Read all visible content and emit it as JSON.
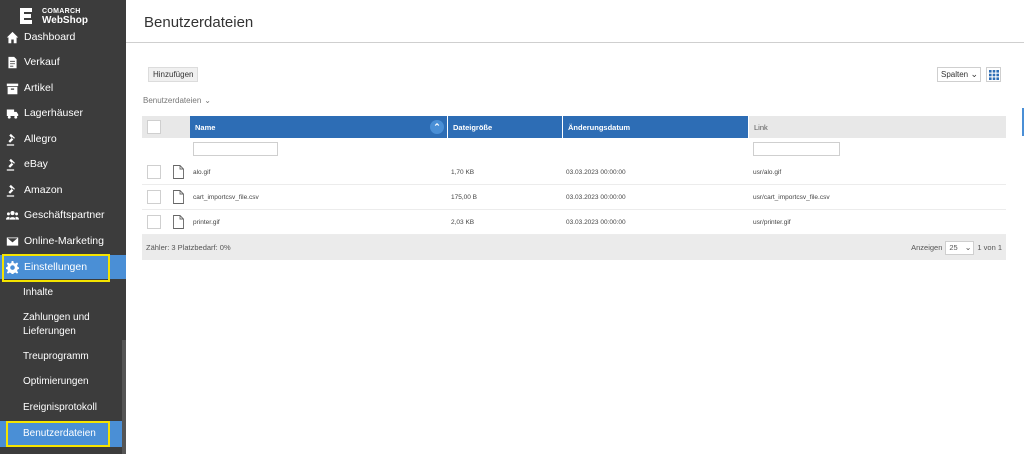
{
  "brand": {
    "company": "COMARCH",
    "product": "WebShop"
  },
  "sidebar": {
    "items": [
      {
        "label": "Dashboard",
        "icon": "home-icon"
      },
      {
        "label": "Verkauf",
        "icon": "document-icon"
      },
      {
        "label": "Artikel",
        "icon": "box-icon"
      },
      {
        "label": "Lagerhäuser",
        "icon": "truck-icon"
      },
      {
        "label": "Allegro",
        "icon": "gavel-icon"
      },
      {
        "label": "eBay",
        "icon": "gavel-icon"
      },
      {
        "label": "Amazon",
        "icon": "gavel-icon"
      },
      {
        "label": "Geschäftspartner",
        "icon": "users-icon"
      },
      {
        "label": "Online-Marketing",
        "icon": "envelope-icon"
      },
      {
        "label": "Einstellungen",
        "icon": "gear-icon"
      }
    ],
    "subitems": [
      {
        "label": "Inhalte"
      },
      {
        "label": "Zahlungen und Lieferungen"
      },
      {
        "label": "Treuprogramm"
      },
      {
        "label": "Optimierungen"
      },
      {
        "label": "Ereignisprotokoll"
      },
      {
        "label": "Benutzerdateien"
      }
    ]
  },
  "page": {
    "title": "Benutzerdateien"
  },
  "toolbar": {
    "add_label": "Hinzufügen",
    "columns_label": "Spalten"
  },
  "breadcrumb": {
    "label": "Benutzerdateien"
  },
  "table": {
    "columns": [
      "Name",
      "Dateigröße",
      "Änderungsdatum",
      "Link"
    ],
    "rows": [
      {
        "name": "alo.gif",
        "size": "1,70 KB",
        "date": "03.03.2023 00:00:00",
        "link": "usr/alo.gif"
      },
      {
        "name": "cart_importcsv_file.csv",
        "size": "175,00 B",
        "date": "03.03.2023 00:00:00",
        "link": "usr/cart_importcsv_file.csv"
      },
      {
        "name": "printer.gif",
        "size": "2,03 KB",
        "date": "03.03.2023 00:00:00",
        "link": "usr/printer.gif"
      }
    ]
  },
  "footer": {
    "counter": "Zähler: 3 Platzbedarf: 0%",
    "show_label": "Anzeigen",
    "page_size": "25",
    "page_info": "1 von 1"
  },
  "colors": {
    "sidebar_bg": "#3c3c3c",
    "accent": "#4a8fd6",
    "header_blue": "#2d6db5",
    "highlight": "#f5e400"
  }
}
